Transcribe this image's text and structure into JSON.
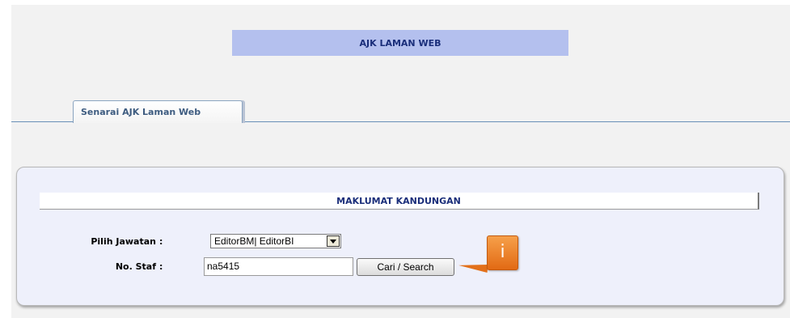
{
  "header": {
    "title": "AJK LAMAN WEB"
  },
  "tabs": [
    {
      "label": "Senarai AJK Laman Web",
      "active": true
    }
  ],
  "panel": {
    "section_title": "MAKLUMAT KANDUNGAN",
    "fields": {
      "jawatan": {
        "label": "Pilih Jawatan",
        "colon": ":",
        "value": "EditorBM| EditorBI"
      },
      "staff": {
        "label": "No. Staf",
        "colon": ":",
        "value": "na5415"
      }
    },
    "search_button": "Cari / Search"
  },
  "callout": {
    "text": "i"
  },
  "colors": {
    "header_bg": "#b4c0ee",
    "header_text": "#1a2e7a",
    "panel_bg": "#eef0fb",
    "accent_orange": "#e26a14",
    "tab_rule": "#6a90b8"
  }
}
